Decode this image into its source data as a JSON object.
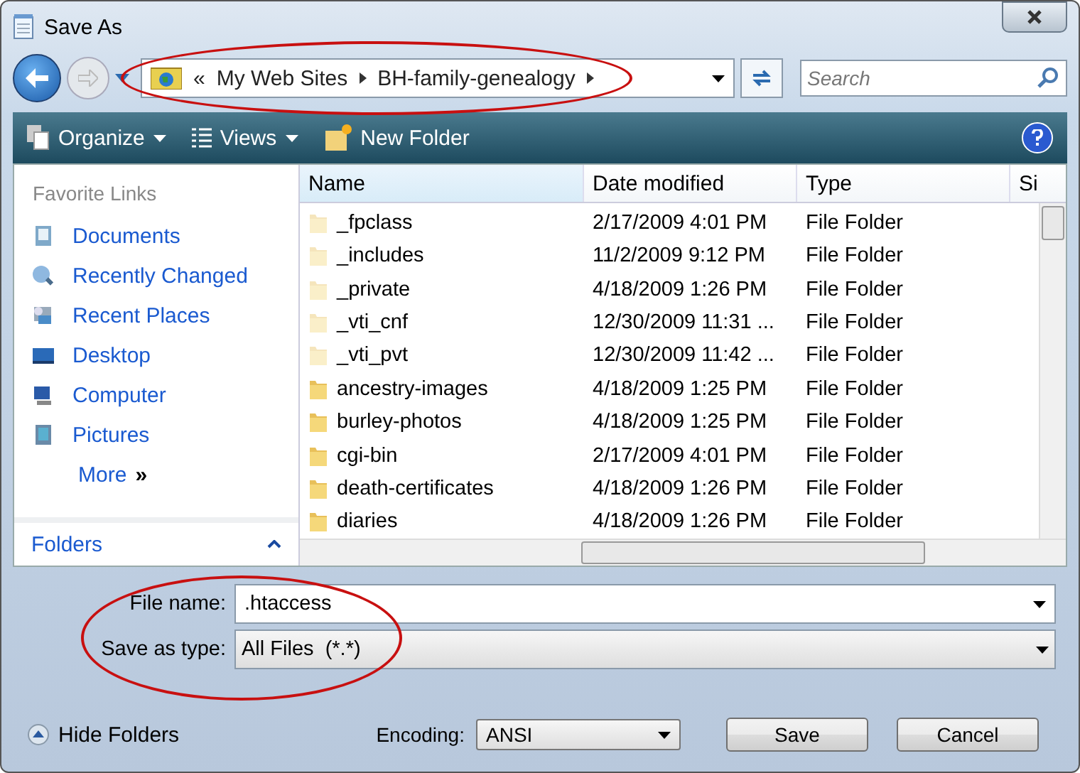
{
  "window": {
    "title": "Save As"
  },
  "address_bar": {
    "highlighted": true,
    "crumbs": [
      "«",
      "My Web Sites",
      "BH-family-genealogy"
    ]
  },
  "search": {
    "placeholder": "Search"
  },
  "toolbar": {
    "items": [
      "Organize",
      "Views",
      "New Folder"
    ]
  },
  "sidebar": {
    "heading": "Favorite Links",
    "items": [
      "Documents",
      "Recently Changed",
      "Recent Places",
      "Desktop",
      "Computer",
      "Pictures"
    ],
    "more": "More",
    "more_glyph": "»",
    "folders": "Folders"
  },
  "table": {
    "columns": [
      "Name",
      "Date modified",
      "Type",
      "Si"
    ],
    "rows": [
      {
        "name": "_fpclass",
        "date": "2/17/2009 4:01 PM",
        "type": "File Folder",
        "hidden": true
      },
      {
        "name": "_includes",
        "date": "11/2/2009 9:12 PM",
        "type": "File Folder",
        "hidden": true
      },
      {
        "name": "_private",
        "date": "4/18/2009 1:26 PM",
        "type": "File Folder",
        "hidden": true
      },
      {
        "name": "_vti_cnf",
        "date": "12/30/2009 11:31 ...",
        "type": "File Folder",
        "hidden": true
      },
      {
        "name": "_vti_pvt",
        "date": "12/30/2009 11:42 ...",
        "type": "File Folder",
        "hidden": true
      },
      {
        "name": "ancestry-images",
        "date": "4/18/2009 1:25 PM",
        "type": "File Folder",
        "hidden": false
      },
      {
        "name": "burley-photos",
        "date": "4/18/2009 1:25 PM",
        "type": "File Folder",
        "hidden": false
      },
      {
        "name": "cgi-bin",
        "date": "2/17/2009 4:01 PM",
        "type": "File Folder",
        "hidden": false
      },
      {
        "name": "death-certificates",
        "date": "4/18/2009 1:26 PM",
        "type": "File Folder",
        "hidden": false
      },
      {
        "name": "diaries",
        "date": "4/18/2009 1:26 PM",
        "type": "File Folder",
        "hidden": false
      }
    ]
  },
  "form": {
    "highlighted": true,
    "file_name_label": "File name:",
    "file_name": ".htaccess",
    "type_label": "Save as type:",
    "type_value": "All Files  (*.*)"
  },
  "footer": {
    "hide_folders": "Hide Folders",
    "encoding_label": "Encoding:",
    "encoding": "ANSI",
    "buttons": [
      "Save",
      "Cancel"
    ]
  }
}
